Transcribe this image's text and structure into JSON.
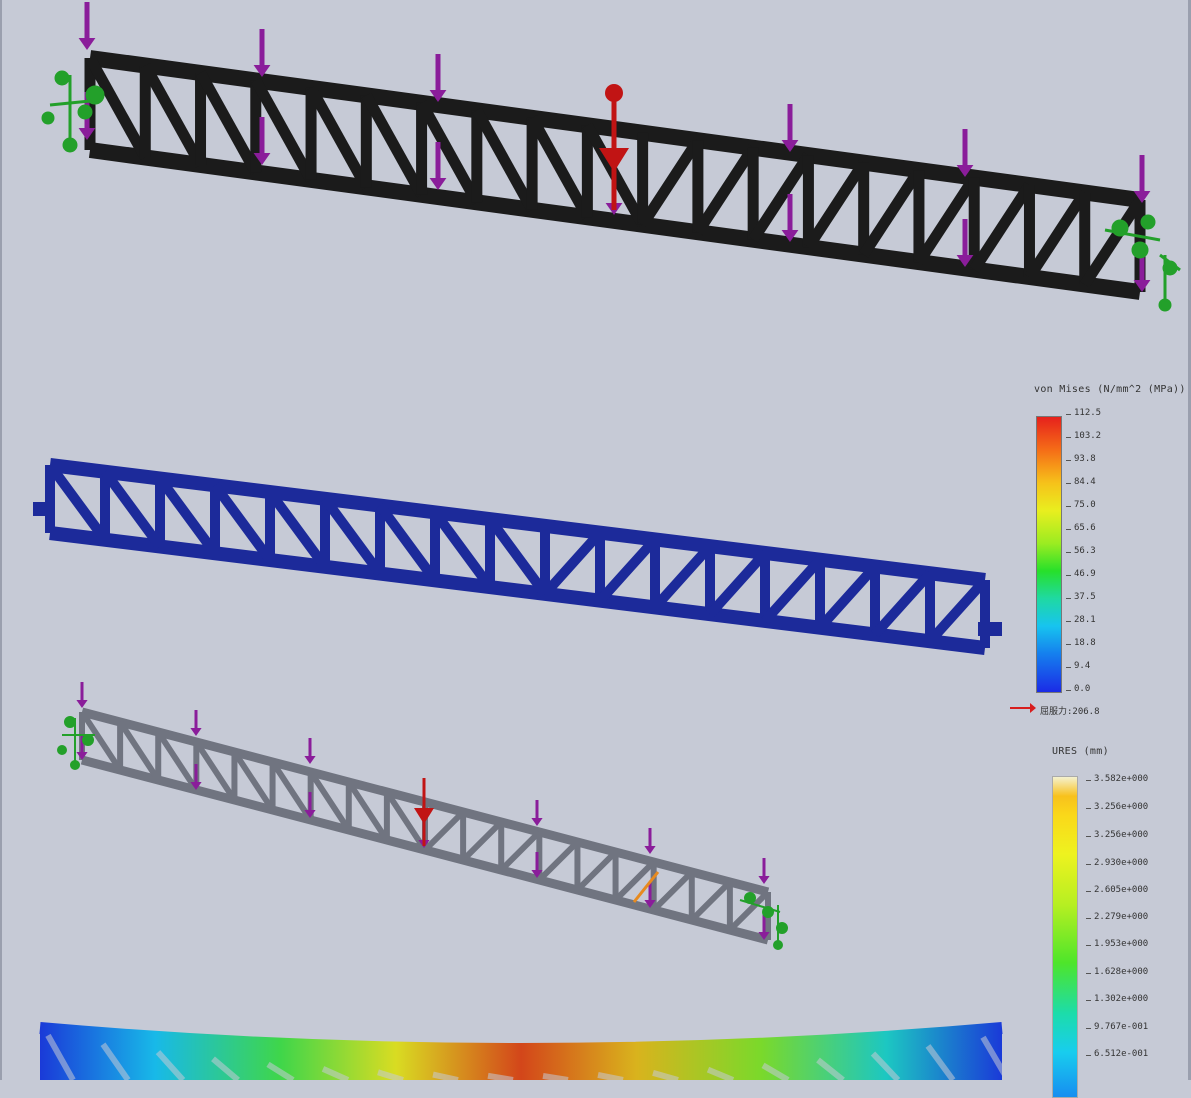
{
  "image_description_free": true,
  "stress_legend": {
    "title": "von Mises (N/mm^2 (MPa))",
    "values": [
      "112.5",
      "103.2",
      "93.8",
      "84.4",
      "75.0",
      "65.6",
      "56.3",
      "46.9",
      "37.5",
      "28.1",
      "18.8",
      "9.4",
      "0.0"
    ],
    "yield_label": "屈服力:206.8",
    "colors": {
      "max": "#e6211c",
      "mid": "#27e02a",
      "min": "#1b2be6"
    }
  },
  "displacement_legend": {
    "title": "URES (mm)",
    "values": [
      "3.582e+000",
      "3.256e+000",
      "3.256e+000",
      "2.930e+000",
      "2.605e+000",
      "2.279e+000",
      "1.953e+000",
      "1.628e+000",
      "1.302e+000",
      "9.767e-001",
      "6.512e-001"
    ]
  },
  "colors": {
    "background": "#c6cad6",
    "truss_mesh": "#1b1b1b",
    "truss_stress": "#1c2a9a",
    "truss_grey": "#707480",
    "load_arrow": "#8a1d9a",
    "center_load": "#c11414",
    "fixture": "#23a02a"
  }
}
